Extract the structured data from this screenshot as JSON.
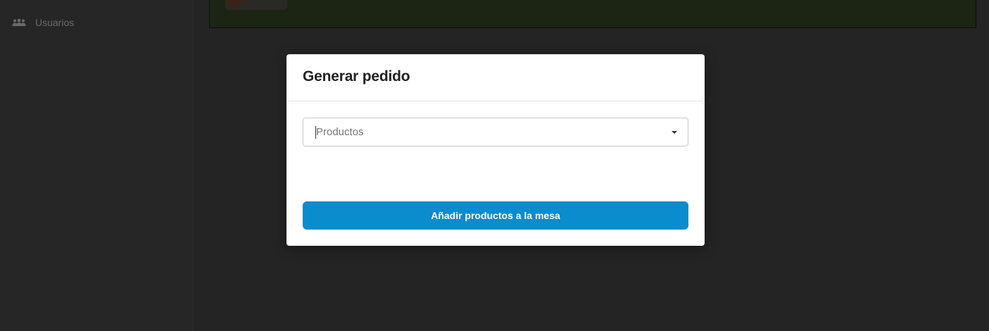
{
  "sidebar": {
    "items": [
      {
        "label": "Usuarios",
        "icon": "users-icon"
      }
    ]
  },
  "modal": {
    "title": "Generar pedido",
    "products_select": {
      "placeholder": "Productos",
      "icon": "chevron-down-icon"
    },
    "submit_label": "Añadir productos a la mesa"
  },
  "colors": {
    "background": "#242424",
    "sidebar_text": "#6a6a6a",
    "modal_background": "#ffffff",
    "primary_button": "#0a8ccd",
    "content_card": "#1c2414"
  }
}
